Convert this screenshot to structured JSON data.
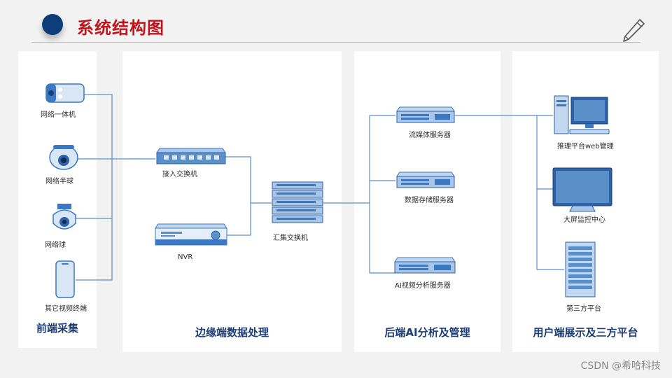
{
  "header": {
    "title": "系统结构图"
  },
  "sections": {
    "front": {
      "title": "前端采集"
    },
    "edge": {
      "title": "边缘端数据处理"
    },
    "backend": {
      "title": "后端AI分析及管理"
    },
    "user": {
      "title": "用户端展示及三方平台"
    }
  },
  "devices": {
    "camera_integrated": "网络一体机",
    "camera_dome_half": "网络半球",
    "camera_dome": "网络球",
    "other_terminal": "其它视频终端",
    "access_switch": "接入交换机",
    "nvr": "NVR",
    "aggregation_switch": "汇集交换机",
    "streaming_server": "流媒体服务器",
    "storage_server": "数据存储服务器",
    "ai_server": "AI视频分析服务器",
    "web_platform": "推理平台web管理",
    "big_screen": "大屏监控中心",
    "third_party": "第三方平台"
  },
  "watermark": "CSDN @希哈科技",
  "colors": {
    "title_red": "#c0141b",
    "section_blue": "#1e3f75",
    "wire_blue": "#5b8fc9",
    "device_blue": "#3a78c4"
  }
}
